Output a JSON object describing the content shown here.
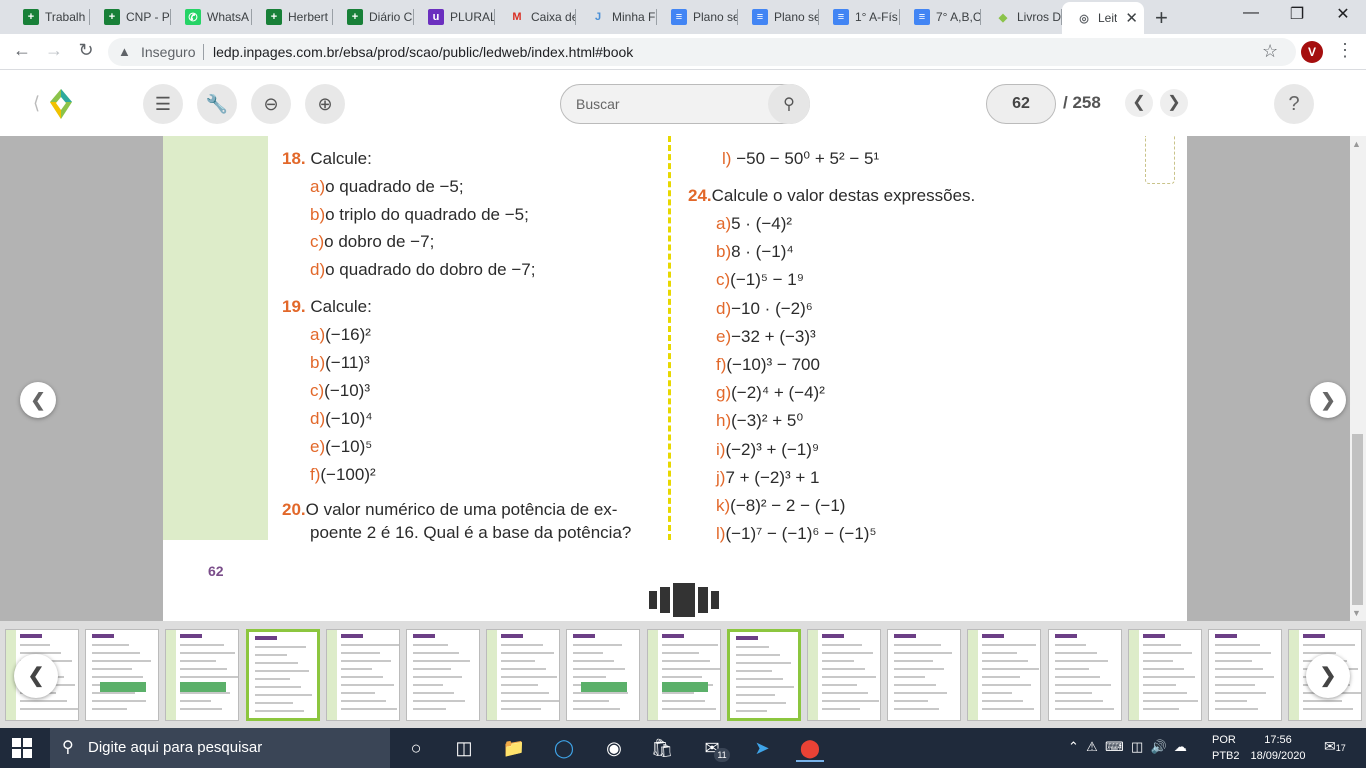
{
  "browser": {
    "tabs": [
      {
        "title": "Trabalh",
        "favicon": "sheets-icon",
        "color": "#188038"
      },
      {
        "title": "CNP - P",
        "favicon": "sheets-icon",
        "color": "#188038"
      },
      {
        "title": "WhatsA",
        "favicon": "whatsapp-icon",
        "color": "#25d366"
      },
      {
        "title": "Herbert",
        "favicon": "sheets-icon",
        "color": "#188038"
      },
      {
        "title": "Diário C",
        "favicon": "sheets-icon",
        "color": "#188038"
      },
      {
        "title": "PLURAL",
        "favicon": "plural-icon",
        "color": "#6b2fbf"
      },
      {
        "title": "Caixa de",
        "favicon": "gmail-icon",
        "color": "#d93025"
      },
      {
        "title": "Minha F",
        "favicon": "minha-icon",
        "color": "#4a8fd6"
      },
      {
        "title": "Plano se",
        "favicon": "docs-icon",
        "color": "#4285f4"
      },
      {
        "title": "Plano se",
        "favicon": "docs-icon",
        "color": "#4285f4"
      },
      {
        "title": "1° A-Fís",
        "favicon": "docs-icon",
        "color": "#4285f4"
      },
      {
        "title": "7° A,B,C",
        "favicon": "docs-icon",
        "color": "#4285f4"
      },
      {
        "title": "Livros D",
        "favicon": "ledp-icon",
        "color": "#8bc34a"
      },
      {
        "title": "Leit",
        "favicon": "globe-icon",
        "color": "#5f6368",
        "active": true
      }
    ],
    "insecure_label": "Inseguro",
    "url": "ledp.inpages.com.br/ebsa/prod/scao/public/ledweb/index.html#book",
    "profile_initial": "V"
  },
  "reader": {
    "search_placeholder": "Buscar",
    "page_current": "62",
    "page_total": "/ 258",
    "help": "?",
    "page_number": "62"
  },
  "content": {
    "ex18": {
      "num": "18.",
      "title": "Calcule:",
      "items": [
        {
          "letter": "a)",
          "text": "o quadrado de −5;"
        },
        {
          "letter": "b)",
          "text": "o triplo do quadrado de −5;"
        },
        {
          "letter": "c)",
          "text": "o dobro de −7;"
        },
        {
          "letter": "d)",
          "text": "o quadrado do dobro de −7;"
        }
      ]
    },
    "ex19": {
      "num": "19.",
      "title": "Calcule:",
      "items": [
        {
          "letter": "a)",
          "text": "(−16)²"
        },
        {
          "letter": "b)",
          "text": "(−11)³"
        },
        {
          "letter": "c)",
          "text": "(−10)³"
        },
        {
          "letter": "d)",
          "text": "(−10)⁴"
        },
        {
          "letter": "e)",
          "text": "(−10)⁵"
        },
        {
          "letter": "f)",
          "text": "(−100)²"
        }
      ]
    },
    "ex20": {
      "num": "20.",
      "line1": "O valor numérico de uma potência de ex-",
      "line2": "poente 2 é 16. Qual é a base da potência?"
    },
    "ex23l": {
      "letter": "l)",
      "text": "−50 − 50⁰ + 5² − 5¹"
    },
    "ex24": {
      "num": "24.",
      "title": "Calcule o valor destas expressões.",
      "items": [
        {
          "letter": "a)",
          "text": "5 · (−4)²"
        },
        {
          "letter": "b)",
          "text": "8 · (−1)⁴"
        },
        {
          "letter": "c)",
          "text": "(−1)⁵ − 1⁹"
        },
        {
          "letter": "d)",
          "text": "−10 · (−2)⁶"
        },
        {
          "letter": "e)",
          "text": "−32 + (−3)³"
        },
        {
          "letter": "f)",
          "text": "(−10)³ − 700"
        },
        {
          "letter": "g)",
          "text": "(−2)⁴ + (−4)²"
        },
        {
          "letter": "h)",
          "text": "(−3)² + 5⁰"
        },
        {
          "letter": "i)",
          "text": "(−2)³ + (−1)⁹"
        },
        {
          "letter": "j)",
          "text": "7 + (−2)³ + 1"
        },
        {
          "letter": "k)",
          "text": "(−8)² − 2 − (−1)"
        },
        {
          "letter": "l)",
          "text": "(−1)⁷ − (−1)⁶ − (−1)⁵"
        }
      ]
    }
  },
  "taskbar": {
    "search_placeholder": "Digite aqui para pesquisar",
    "mail_badge": "11",
    "lang_line1": "POR",
    "lang_line2": "PTB2",
    "time": "17:56",
    "date": "18/09/2020",
    "notification_count": "17"
  }
}
